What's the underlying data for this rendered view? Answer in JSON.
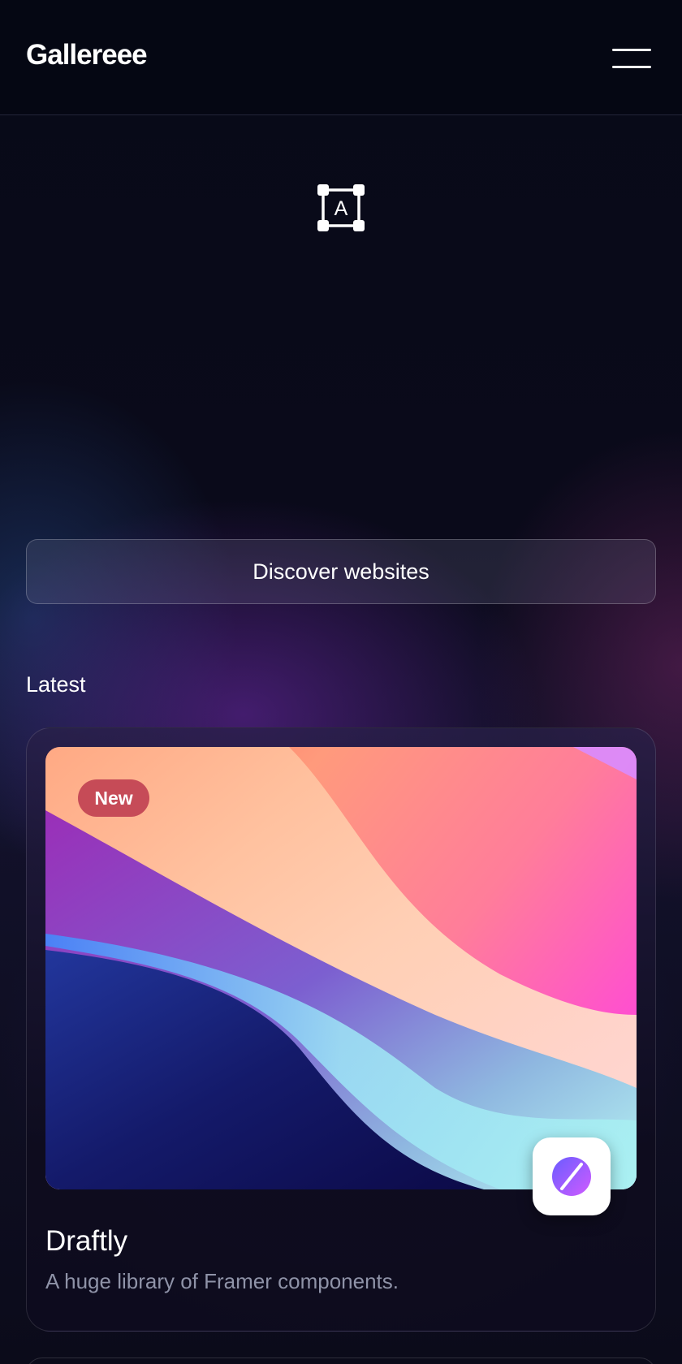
{
  "header": {
    "logo_text": "Gallereee",
    "menu_icon": "hamburger-menu-icon"
  },
  "hero": {
    "icon": "text-frame-icon",
    "icon_letter": "A"
  },
  "actions": {
    "discover_label": "Discover websites"
  },
  "latest": {
    "section_title": "Latest",
    "cards": [
      {
        "badge": "New",
        "title": "Draftly",
        "description": "A huge library of Framer components.",
        "app_icon": "draftly-logo-icon"
      }
    ]
  },
  "colors": {
    "background": "#070914",
    "badge": "#be3c50",
    "muted_text": "#8f93a8"
  }
}
